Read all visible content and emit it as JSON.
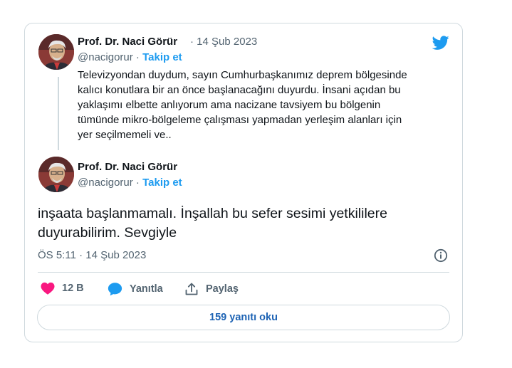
{
  "tweet1": {
    "name": "Prof. Dr. Naci Görür",
    "date": "14 Şub 2023",
    "handle": "@nacigorur",
    "follow": "Takip et",
    "lines": [
      "Televizyondan duydum, sayın Cumhurbaşkanımız deprem bölgesinde",
      "kalıcı konutlara bir an önce başlanacağını duyurdu. İnsani açıdan bu",
      "yaklaşımı elbette anlıyorum ama nacizane tavsiyem bu bölgenin",
      "tümünde mikro-bölgeleme çalışması yapmadan yerleşim alanları için",
      "yer seçilmemeli ve.."
    ]
  },
  "tweet2": {
    "name": "Prof. Dr. Naci Görür",
    "handle": "@nacigorur",
    "follow": "Takip et",
    "lines": [
      "inşaata başlanmamalı. İnşallah bu sefer sesimi yetkililere",
      "duyurabilirim. Sevgiyle"
    ],
    "timestamp": "ÖS 5:11 · 14 Şub 2023"
  },
  "actions": {
    "likes": "12 B",
    "reply": "Yanıtla",
    "share": "Paylaş"
  },
  "replies_button": "159 yanıtı oku",
  "icons": [
    "twitter-bird-icon",
    "heart-icon",
    "reply-bubble-icon",
    "share-icon",
    "info-icon"
  ],
  "colors": {
    "twitter_blue": "#1d9bf0",
    "heart": "#f91880",
    "text": "#0f1419",
    "muted": "#536471",
    "border": "#cfd9de"
  }
}
